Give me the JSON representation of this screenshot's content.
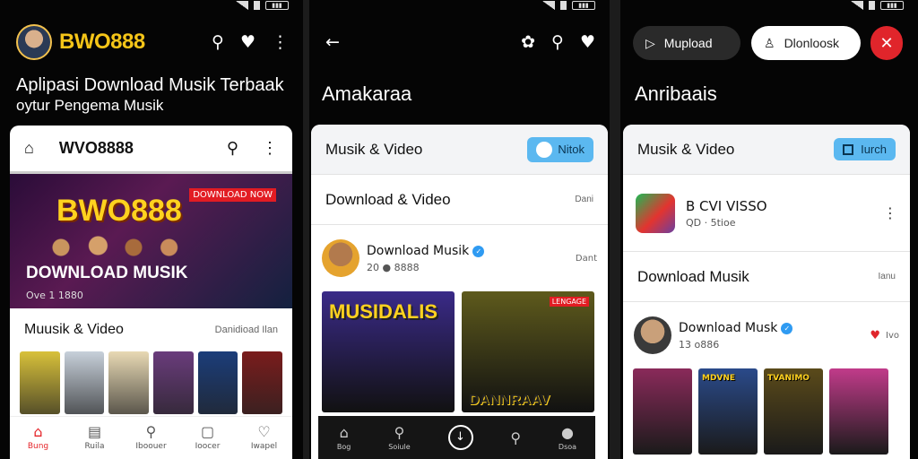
{
  "screen1": {
    "brand": "BWO888",
    "title_line1": "Aplipasi Download Musik Terbaak",
    "title_line2": "oytur Pengema Musik",
    "appbar_title": "WVO8888",
    "banner": {
      "brand": "BWO888",
      "badge": "DOWNLOAD NOW",
      "headline": "DOWNLOAD MUSIK",
      "count": "Ove 1 1880"
    },
    "section_title": "Muusik & Video",
    "section_link": "Danidioad Ilan",
    "thumb_colors": [
      "#d8c13a",
      "#c7d0da",
      "#e8d9b4",
      "#6a3c7c",
      "#1b3d7a",
      "#7a1c1c"
    ],
    "nav": [
      {
        "label": "Bung",
        "icon": "home-icon",
        "glyph": "⌂",
        "active": true
      },
      {
        "label": "Ruila",
        "icon": "library-icon",
        "glyph": "▤",
        "active": false
      },
      {
        "label": "Iboouer",
        "icon": "search-icon",
        "glyph": "⚲",
        "active": false
      },
      {
        "label": "Ioocer",
        "icon": "chat-icon",
        "glyph": "▢",
        "active": false
      },
      {
        "label": "Iwapel",
        "icon": "heart-icon",
        "glyph": "♡",
        "active": false
      }
    ]
  },
  "screen2": {
    "title": "Amakaraa",
    "section_header": "Musik & Video",
    "chip_label": "Nitok",
    "section2_title": "Download & Video",
    "section2_link": "Dani",
    "profile_name": "Download Musik",
    "profile_meta": "20 ● 8888",
    "profile_action": "Dant",
    "posters": [
      {
        "title": "MUSIDALIS",
        "bg": "#3a2a88",
        "badge": ""
      },
      {
        "title": "DANNRAAV",
        "bg": "#5e5a1c",
        "badge": "LENGAGE"
      }
    ],
    "nav": [
      {
        "label": "Bog",
        "icon": "home-icon",
        "glyph": "⌂"
      },
      {
        "label": "Soiule",
        "icon": "search-icon",
        "glyph": "⚲"
      },
      {
        "label": "",
        "icon": "clock-icon",
        "glyph": "↓"
      },
      {
        "label": "",
        "icon": "search-icon",
        "glyph": "⚲"
      },
      {
        "label": "Dsoa",
        "icon": "profile-icon",
        "glyph": "●"
      }
    ]
  },
  "screen3": {
    "pill_upload": "Mupload",
    "pill_download": "Dlonloosk",
    "title": "Anribaais",
    "section_header": "Musik & Video",
    "chip_label": "Iurch",
    "app_name": "B CVI VISSO",
    "app_meta": "QD  · 5tioe",
    "section2_title": "Download Musik",
    "section2_link": "Ianu",
    "profile_name": "Download Musk",
    "profile_meta": "13 o886",
    "profile_action": "Ivo",
    "posters": [
      {
        "title": "",
        "bg": "#8a2a5a"
      },
      {
        "title": "MDVNE",
        "bg": "#2a4a8a"
      },
      {
        "title": "TVANIMO",
        "bg": "#5a4a1a"
      },
      {
        "title": "",
        "bg": "#c13b8a"
      }
    ]
  }
}
